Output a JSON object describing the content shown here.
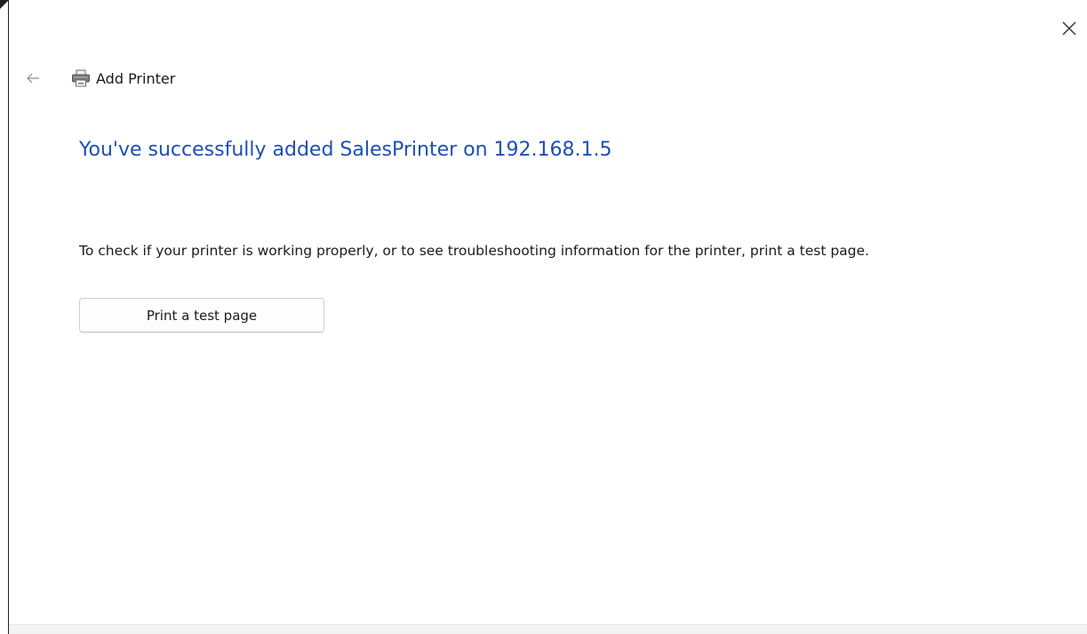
{
  "window": {
    "title": "Add Printer"
  },
  "content": {
    "heading": "You've successfully added SalesPrinter on 192.168.1.5",
    "instruction": "To check if your printer is working properly, or to see troubleshooting information for the printer, print a test page.",
    "test_button_label": "Print a test page"
  },
  "icons": {
    "back": "back-arrow-icon",
    "printer": "printer-icon",
    "close": "close-icon"
  },
  "colors": {
    "heading": "#1b50b5",
    "text": "#1a1a1a",
    "background": "#ffffff"
  }
}
